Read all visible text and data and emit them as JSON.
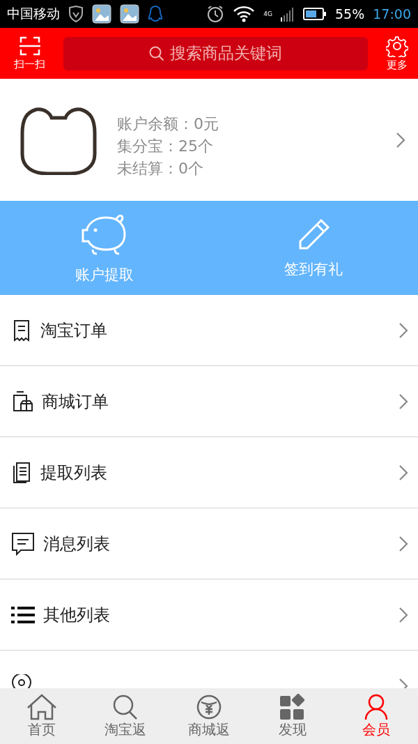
{
  "status_bar": {
    "carrier": "中国移动",
    "signal": "4G",
    "battery": "55%",
    "time": "17:00"
  },
  "header": {
    "scan_label": "扫一扫",
    "search": {
      "placeholder": "搜索商品关键词"
    },
    "more_label": "更多"
  },
  "profile": {
    "stats": [
      "账户余额：0元",
      "集分宝：25个",
      "未结算：0个"
    ]
  },
  "actions": [
    {
      "label": "账户提取"
    },
    {
      "label": "签到有礼"
    }
  ],
  "menu": [
    {
      "kind": "row",
      "label": "淘宝订单"
    },
    {
      "kind": "row",
      "label": "商城订单"
    },
    {
      "kind": "row",
      "label": "提取列表"
    },
    {
      "kind": "row",
      "label": "消息列表"
    },
    {
      "kind": "row",
      "label": "其他列表"
    },
    {
      "kind": "cut"
    }
  ],
  "nav": [
    {
      "label": "首页",
      "selected": false
    },
    {
      "label": "淘宝返",
      "selected": false
    },
    {
      "label": "商城返",
      "selected": false
    },
    {
      "label": "发现",
      "selected": false
    },
    {
      "label": "会员",
      "selected": true
    }
  ]
}
